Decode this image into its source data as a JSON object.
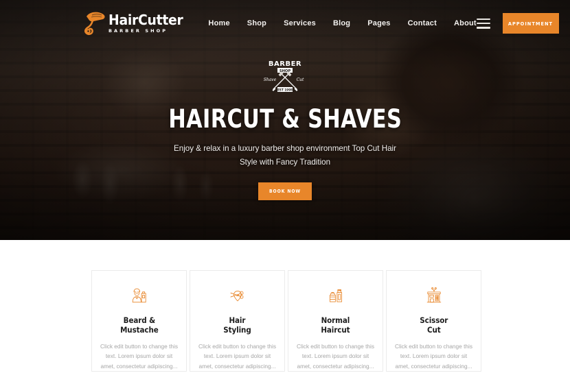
{
  "brand": {
    "name": "HairCutter",
    "tagline": "BARBER SHOP",
    "logo_icon": "razor-logo-icon",
    "accent_color": "#e8862a"
  },
  "nav": {
    "items": [
      {
        "label": "Home"
      },
      {
        "label": "Shop"
      },
      {
        "label": "Services"
      },
      {
        "label": "Blog"
      },
      {
        "label": "Pages"
      },
      {
        "label": "Contact"
      },
      {
        "label": "About"
      }
    ],
    "menu_icon": "hamburger-menu-icon",
    "appointment_label": "APPOINTMENT"
  },
  "hero": {
    "emblem": {
      "icon": "barber-shop-crossed-razors-emblem",
      "top_text": "BARBER",
      "banner_text": "SHOP",
      "left_text": "Shave",
      "right_text": "Cut",
      "bottom_text": "EST 1998"
    },
    "title": "HAIRCUT & SHAVES",
    "subtitle": "Enjoy & relax in a luxury barber shop environment Top Cut Hair Style with Fancy Tradition",
    "cta_label": "BOOK NOW",
    "background_image": "barber-shop-interior-photo"
  },
  "services": {
    "cards": [
      {
        "icon": "barber-with-bottle-icon",
        "title": "Beard &\nMustache",
        "text": "Click edit button to change this text. Lorem ipsum dolor sit amet, consectetur adipiscing..."
      },
      {
        "icon": "scissors-pin-icon",
        "title": "Hair\nStyling",
        "text": "Click edit button to change this text. Lorem ipsum dolor sit amet, consectetur adipiscing..."
      },
      {
        "icon": "cream-jar-and-tube-icon",
        "title": "Normal\nHaircut",
        "text": "Click edit button to change this text. Lorem ipsum dolor sit amet, consectetur adipiscing..."
      },
      {
        "icon": "barber-storefront-icon",
        "title": "Scissor\nCut",
        "text": "Click edit button to change this text. Lorem ipsum dolor sit amet, consectetur adipiscing..."
      }
    ]
  }
}
